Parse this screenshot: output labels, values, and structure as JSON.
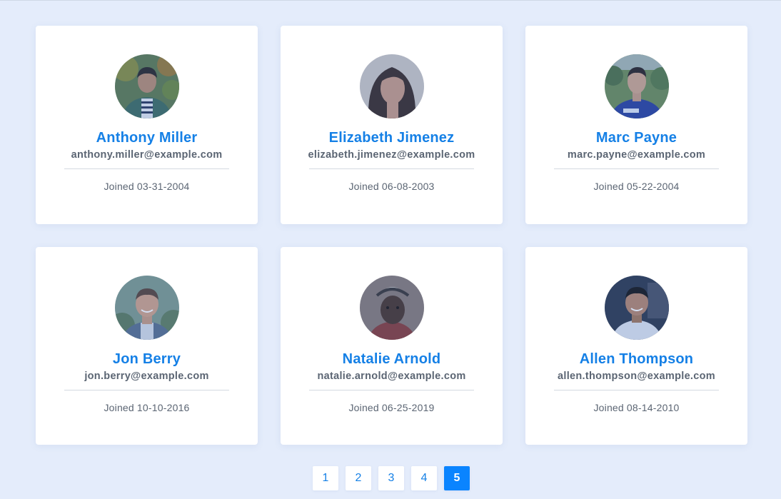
{
  "joined_prefix": "Joined",
  "users": [
    {
      "name": "Anthony Miller",
      "email": "anthony.miller@example.com",
      "joined": "03-31-2004"
    },
    {
      "name": "Elizabeth Jimenez",
      "email": "elizabeth.jimenez@example.com",
      "joined": "06-08-2003"
    },
    {
      "name": "Marc Payne",
      "email": "marc.payne@example.com",
      "joined": "05-22-2004"
    },
    {
      "name": "Jon Berry",
      "email": "jon.berry@example.com",
      "joined": "10-10-2016"
    },
    {
      "name": "Natalie Arnold",
      "email": "natalie.arnold@example.com",
      "joined": "06-25-2019"
    },
    {
      "name": "Allen Thompson",
      "email": "allen.thompson@example.com",
      "joined": "08-14-2010"
    }
  ],
  "pagination": {
    "pages": [
      "1",
      "2",
      "3",
      "4",
      "5"
    ],
    "current": "5"
  },
  "colors": {
    "background": "#e4ecfb",
    "accent": "#1580e6",
    "active_page": "#0a84ff",
    "text_muted": "#5b6573"
  }
}
